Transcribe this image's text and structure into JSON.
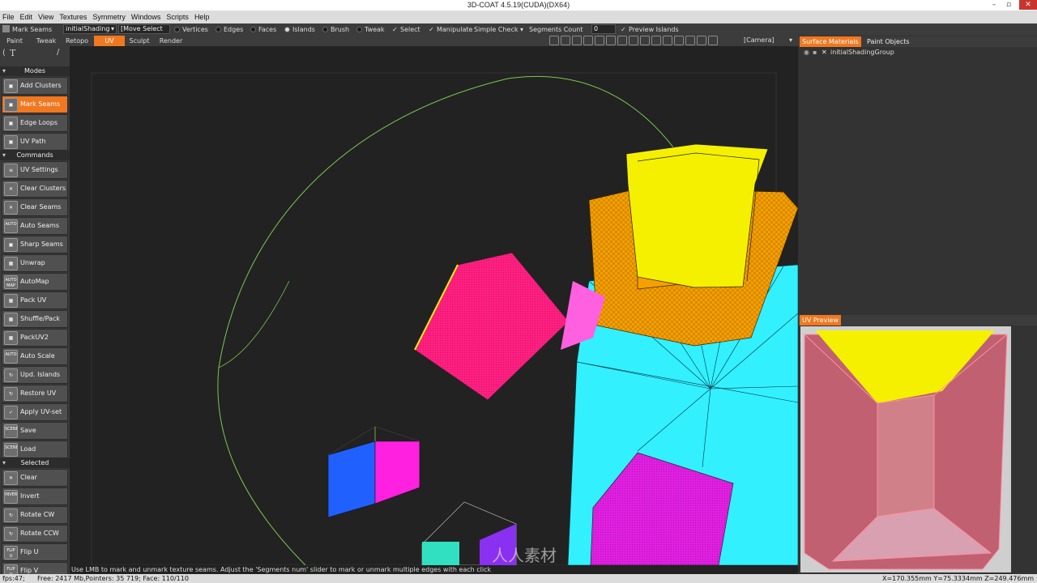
{
  "window": {
    "title": "3D-COAT 4.5.19(CUDA)(DX64)",
    "min": "–",
    "max": "▫",
    "close": "✕"
  },
  "menu": [
    "File",
    "Edit",
    "View",
    "Textures",
    "Symmetry",
    "Windows",
    "Scripts",
    "Help"
  ],
  "toolbar": {
    "tool_label": "Mark Seams",
    "shading_group": "initialShading",
    "move_select": "[Move Select",
    "vertices": "Vertices",
    "edges": "Edges",
    "faces": "Faces",
    "islands": "Islands",
    "brush": "Brush",
    "tweak": "Tweak",
    "select": "Select",
    "manipulate": "Manipulate",
    "simple_check": "Simple Check",
    "segments_count": "Segments Count",
    "segments_value": "0",
    "preview_islands": "Preview Islands"
  },
  "rooms": [
    "Paint",
    "Tweak",
    "Retopo",
    "UV",
    "Sculpt",
    "Render"
  ],
  "active_room": "UV",
  "camera_label": "[Camera]",
  "sidebar": {
    "modes_header": "Modes",
    "modes": [
      {
        "label": "Add Clusters",
        "icon": "cube-icon",
        "active": false
      },
      {
        "label": "Mark Seams",
        "icon": "cube-icon",
        "active": true
      },
      {
        "label": "Edge Loops",
        "icon": "cube-icon",
        "active": false
      },
      {
        "label": "UV Path",
        "icon": "cube-icon",
        "active": false
      }
    ],
    "commands_header": "Commands",
    "commands": [
      {
        "label": "UV Settings",
        "icon": "settings-icon"
      },
      {
        "label": "Clear Clusters",
        "icon": "clear-icon"
      },
      {
        "label": "Clear Seams",
        "icon": "clear-icon"
      },
      {
        "label": "Auto Seams",
        "icon": "auto-icon"
      },
      {
        "label": "Sharp Seams",
        "icon": "cube-icon"
      },
      {
        "label": "Unwrap",
        "icon": "grid-icon"
      },
      {
        "label": "AutoMap",
        "icon": "automap-icon"
      },
      {
        "label": "Pack UV",
        "icon": "pack-icon"
      },
      {
        "label": "Shuffle/Pack",
        "icon": "shuffle-icon"
      },
      {
        "label": "PackUV2",
        "icon": "grid-icon"
      },
      {
        "label": "Auto Scale",
        "icon": "auto-icon"
      },
      {
        "label": "Upd. Islands",
        "icon": "update-icon"
      },
      {
        "label": "Restore UV",
        "icon": "restore-icon"
      },
      {
        "label": "Apply UV-set",
        "icon": "check-icon"
      },
      {
        "label": "Save",
        "icon": "scene-icon"
      },
      {
        "label": "Load",
        "icon": "scene-icon"
      }
    ],
    "selected_header": "Selected",
    "selected": [
      {
        "label": "Clear",
        "icon": "clear-icon"
      },
      {
        "label": "Invert",
        "icon": "invert-icon"
      },
      {
        "label": "Rotate CW",
        "icon": "rotate-cw-icon"
      },
      {
        "label": "Rotate CCW",
        "icon": "rotate-ccw-icon"
      },
      {
        "label": "Flip U",
        "icon": "flip-u-icon"
      },
      {
        "label": "Flip V",
        "icon": "flip-v-icon"
      }
    ]
  },
  "icon_glyphs": {
    "auto": "AUTO",
    "automap": "AUTO MAP",
    "scene": "SCENE",
    "invert": "INVERT",
    "flip_u": "FLIP U",
    "flip_v": "FLIP V"
  },
  "right_panel": {
    "tabs": [
      "Surface Materials",
      "Paint Objects"
    ],
    "material_row": "initialShadingGroup",
    "uv_preview_label": "UV Preview"
  },
  "status": {
    "hint": "Use LMB to mark and unmark texture seams. Adjust the 'Segments num' slider to mark or unmark multiple edges with each click",
    "fps": "fps:47;",
    "memory": "Free: 2417 Mb,Pointers: 35 719; Face: 110/110",
    "coords": "X=170.355mm  Y=75.3334mm  Z=249.476mm"
  },
  "watermark": "人人素材",
  "colors": {
    "accent": "#f07820",
    "viewport": "#222222",
    "yellow": "#f5f000",
    "orange": "#f5a000",
    "pink": "#ff1f7a",
    "cyan": "#33f0ff",
    "magenta": "#e020e0",
    "blue": "#2060ff",
    "purple": "#8a30f0"
  }
}
